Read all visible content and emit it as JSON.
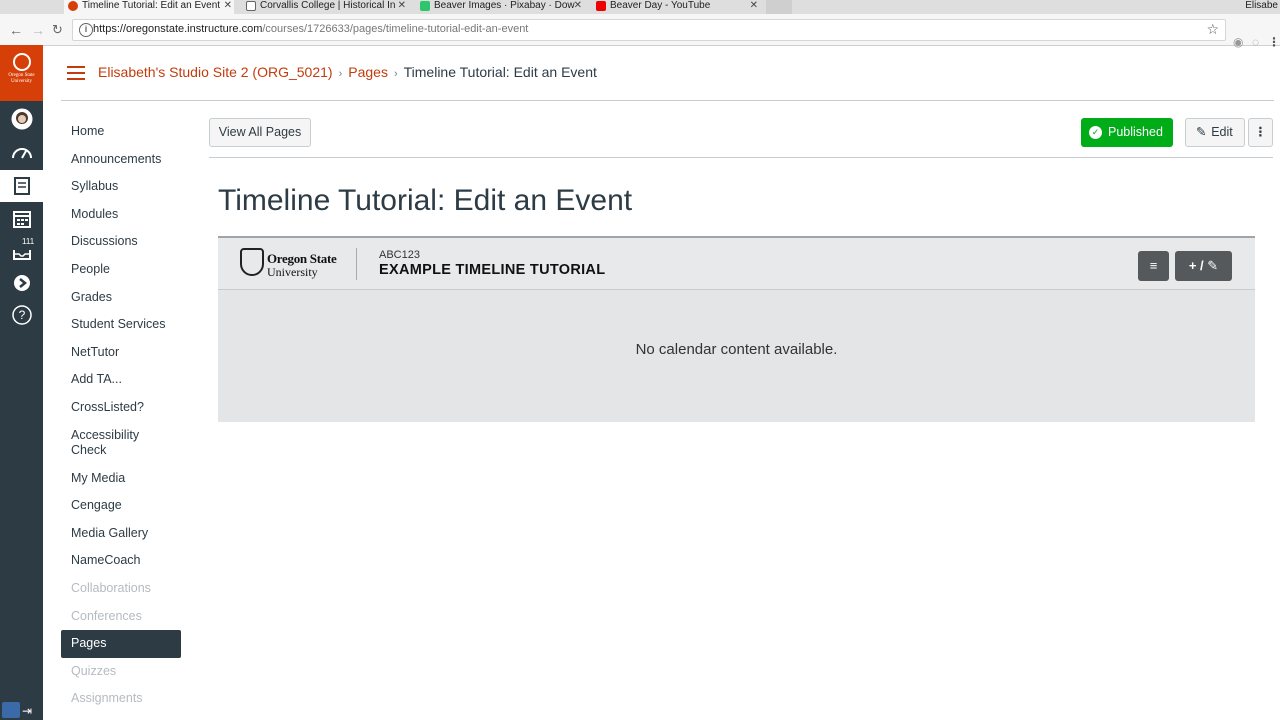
{
  "browser": {
    "tabs": [
      {
        "title": "Timeline Tutorial: Edit an Event",
        "active": true,
        "icon": "osu-favicon-icon"
      },
      {
        "title": "Corvallis College | Historical In",
        "active": false,
        "icon": "page-icon"
      },
      {
        "title": "Beaver Images · Pixabay · Dow",
        "active": false,
        "icon": "pixabay-icon"
      },
      {
        "title": "Beaver Day - YouTube",
        "active": false,
        "icon": "youtube-icon"
      }
    ],
    "user": "Elisabe",
    "url_host": "https://oregonstate.instructure.com",
    "url_path": "/courses/1726633/pages/timeline-tutorial-edit-an-event"
  },
  "global_nav": {
    "logo_text_line1": "Oregon State",
    "logo_text_line2": "University",
    "inbox_badge": "111",
    "items": [
      "account",
      "dashboard",
      "courses",
      "calendar",
      "inbox",
      "commons",
      "help"
    ]
  },
  "header": {
    "course_name": "Elisabeth's Studio Site 2 (ORG_5021)",
    "section": "Pages",
    "current_page": "Timeline Tutorial: Edit an Event"
  },
  "course_nav": {
    "items": [
      {
        "label": "Home",
        "disabled": false,
        "active": false
      },
      {
        "label": "Announcements",
        "disabled": false,
        "active": false
      },
      {
        "label": "Syllabus",
        "disabled": false,
        "active": false
      },
      {
        "label": "Modules",
        "disabled": false,
        "active": false
      },
      {
        "label": "Discussions",
        "disabled": false,
        "active": false
      },
      {
        "label": "People",
        "disabled": false,
        "active": false
      },
      {
        "label": "Grades",
        "disabled": false,
        "active": false
      },
      {
        "label": "Student Services",
        "disabled": false,
        "active": false
      },
      {
        "label": "NetTutor",
        "disabled": false,
        "active": false
      },
      {
        "label": "Add TA...",
        "disabled": false,
        "active": false
      },
      {
        "label": "CrossListed?",
        "disabled": false,
        "active": false
      },
      {
        "label": "Accessibility Check",
        "disabled": false,
        "active": false
      },
      {
        "label": "My Media",
        "disabled": false,
        "active": false
      },
      {
        "label": "Cengage",
        "disabled": false,
        "active": false
      },
      {
        "label": "Media Gallery",
        "disabled": false,
        "active": false
      },
      {
        "label": "NameCoach",
        "disabled": false,
        "active": false
      },
      {
        "label": "Collaborations",
        "disabled": true,
        "active": false
      },
      {
        "label": "Conferences",
        "disabled": true,
        "active": false
      },
      {
        "label": "Pages",
        "disabled": false,
        "active": true
      },
      {
        "label": "Quizzes",
        "disabled": true,
        "active": false
      },
      {
        "label": "Assignments",
        "disabled": true,
        "active": false
      }
    ]
  },
  "toolbar": {
    "view_all_label": "View All Pages",
    "published_label": "Published",
    "edit_label": "Edit"
  },
  "page": {
    "title": "Timeline Tutorial: Edit an Event"
  },
  "timeline": {
    "logo_line1": "Oregon State",
    "logo_line2": "University",
    "course_code": "ABC123",
    "course_title": "EXAMPLE TIMELINE TUTORIAL",
    "add_edit_label": "+ / ✎",
    "empty_message": "No calendar content available."
  },
  "colors": {
    "brand": "#d73f09",
    "link": "#c23c0d",
    "nav_bg": "#2d3b45",
    "published": "#00ac18"
  }
}
